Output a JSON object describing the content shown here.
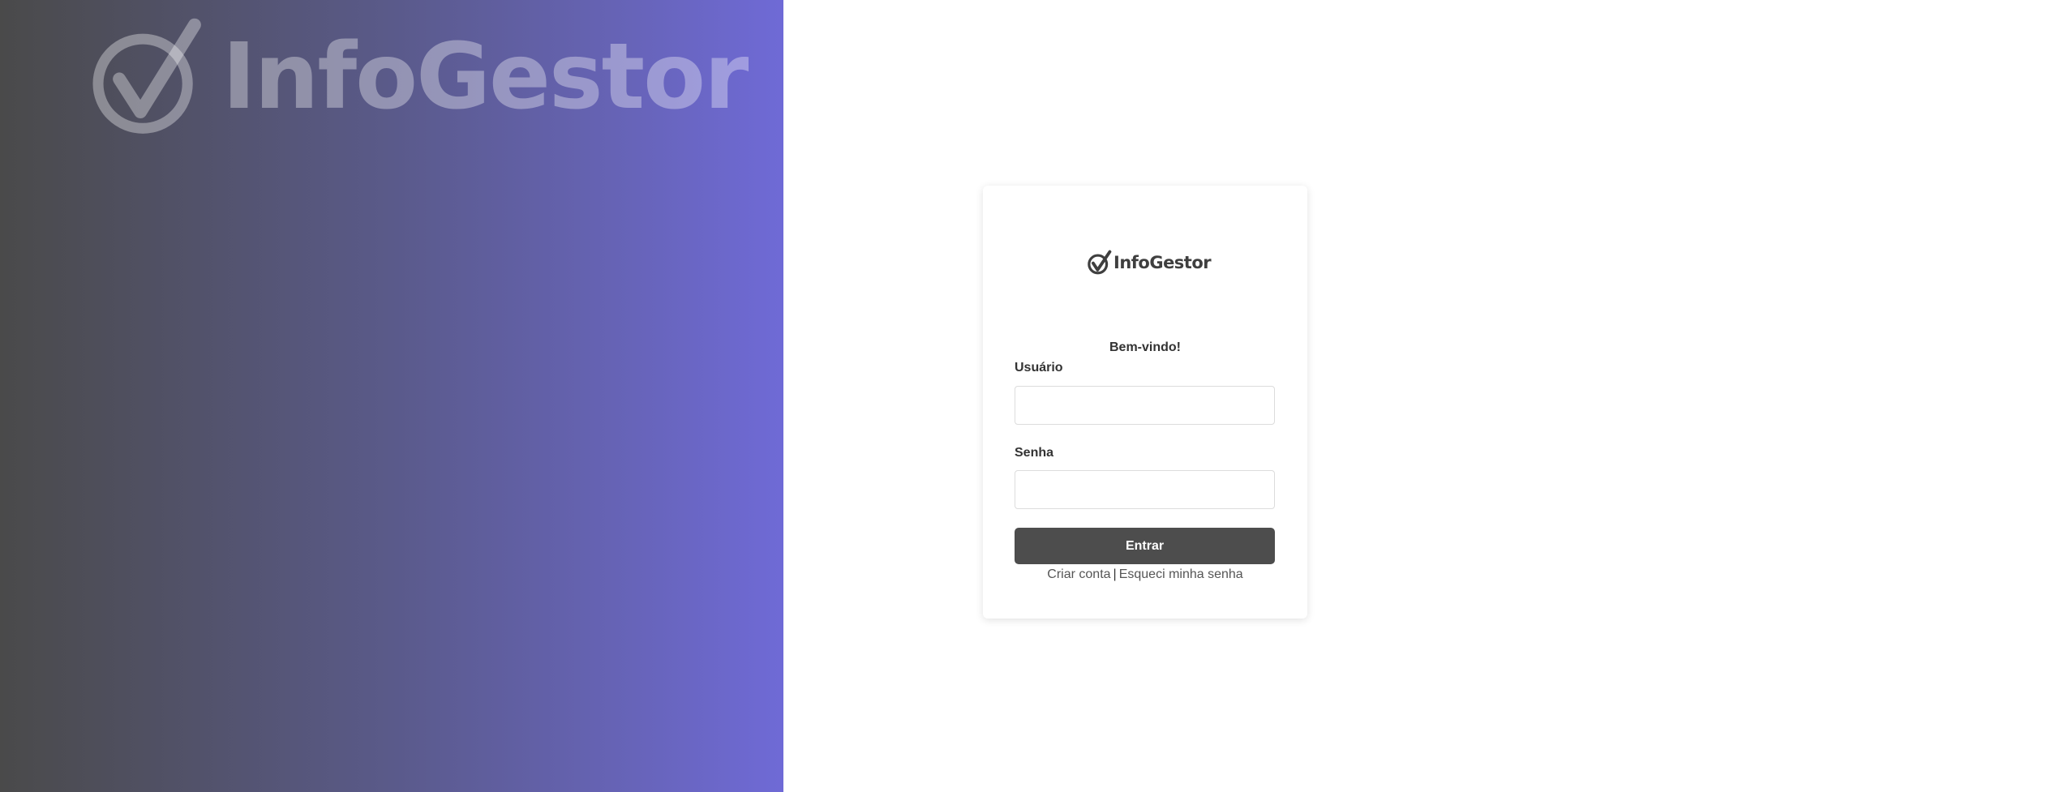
{
  "brand": {
    "name": "InfoGestor",
    "colors": {
      "gradient_start": "#4a4a4a",
      "gradient_end": "#6f6ad6",
      "button": "#4d4d4d"
    },
    "logo_icon": "check-circle-icon"
  },
  "login": {
    "welcome": "Bem-vindo!",
    "username_label": "Usuário",
    "username_value": "",
    "password_label": "Senha",
    "password_value": "",
    "submit_label": "Entrar",
    "create_account_link": "Criar conta",
    "separator": "|",
    "forgot_password_link": "Esqueci minha senha"
  }
}
